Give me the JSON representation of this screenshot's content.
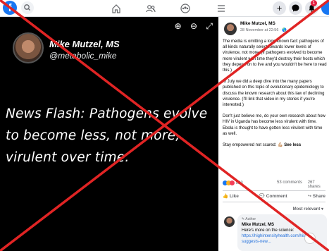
{
  "topbar": {
    "logo_letter": "f",
    "icons": [
      "facebook-logo",
      "search-icon",
      "home-icon",
      "friends-icon",
      "groups-icon",
      "menu-icon",
      "plus-icon",
      "messenger-icon",
      "bell-icon",
      "account-icon"
    ],
    "notification_count": "1"
  },
  "media": {
    "tool_icons": [
      "zoom-in-icon",
      "zoom-out-icon",
      "fullscreen-icon"
    ],
    "tweet": {
      "name": "Mike Mutzel, MS",
      "handle": "@metabolic_mike",
      "text": "News Flash: Pathogens evolve to become less, not more, virulent over time."
    }
  },
  "post": {
    "author": "Mike Mutzel, MS",
    "date": "28 November at 22:56 · 🌎",
    "paragraphs": [
      "The media is omitting a long-known fact: pathogens of all kinds naturally select towards lower levels of virulence, not more. (If pathogens evolved to become more virulent with time they'd destroy their hosts which they depend on to live and you wouldn't be here to read this.)",
      "In July we did a deep dive into the many papers published on this topic of evolutionary epidemiology to discuss the known research about this law of declining virulence. (I'll link that video in my stories if you're interested.)",
      "Don't just believe me, do your own research about how HIV in Uganda has become less virulent with time. Ebola is thought to have gotten less virulent with time as well."
    ],
    "closing": "Stay empowered not scared: 💪🏼",
    "see_less": "See less",
    "reaction_count": "523",
    "comments_count": "53 comments",
    "shares_count": "267 shares",
    "actions": {
      "like": "Like",
      "comment": "Comment",
      "share": "Share"
    },
    "sort_label": "Most relevant ▾"
  },
  "comment": {
    "tag": "✎ Author",
    "name": "Mike Mutzel, MS",
    "text": "Here's more on the science:",
    "link": "https://highintensityhealth.com/history-suggests-new..."
  },
  "colors": {
    "brand": "#1877f2",
    "cross": "#e02424",
    "link": "#216fdb",
    "badge": "#e41e3f"
  }
}
